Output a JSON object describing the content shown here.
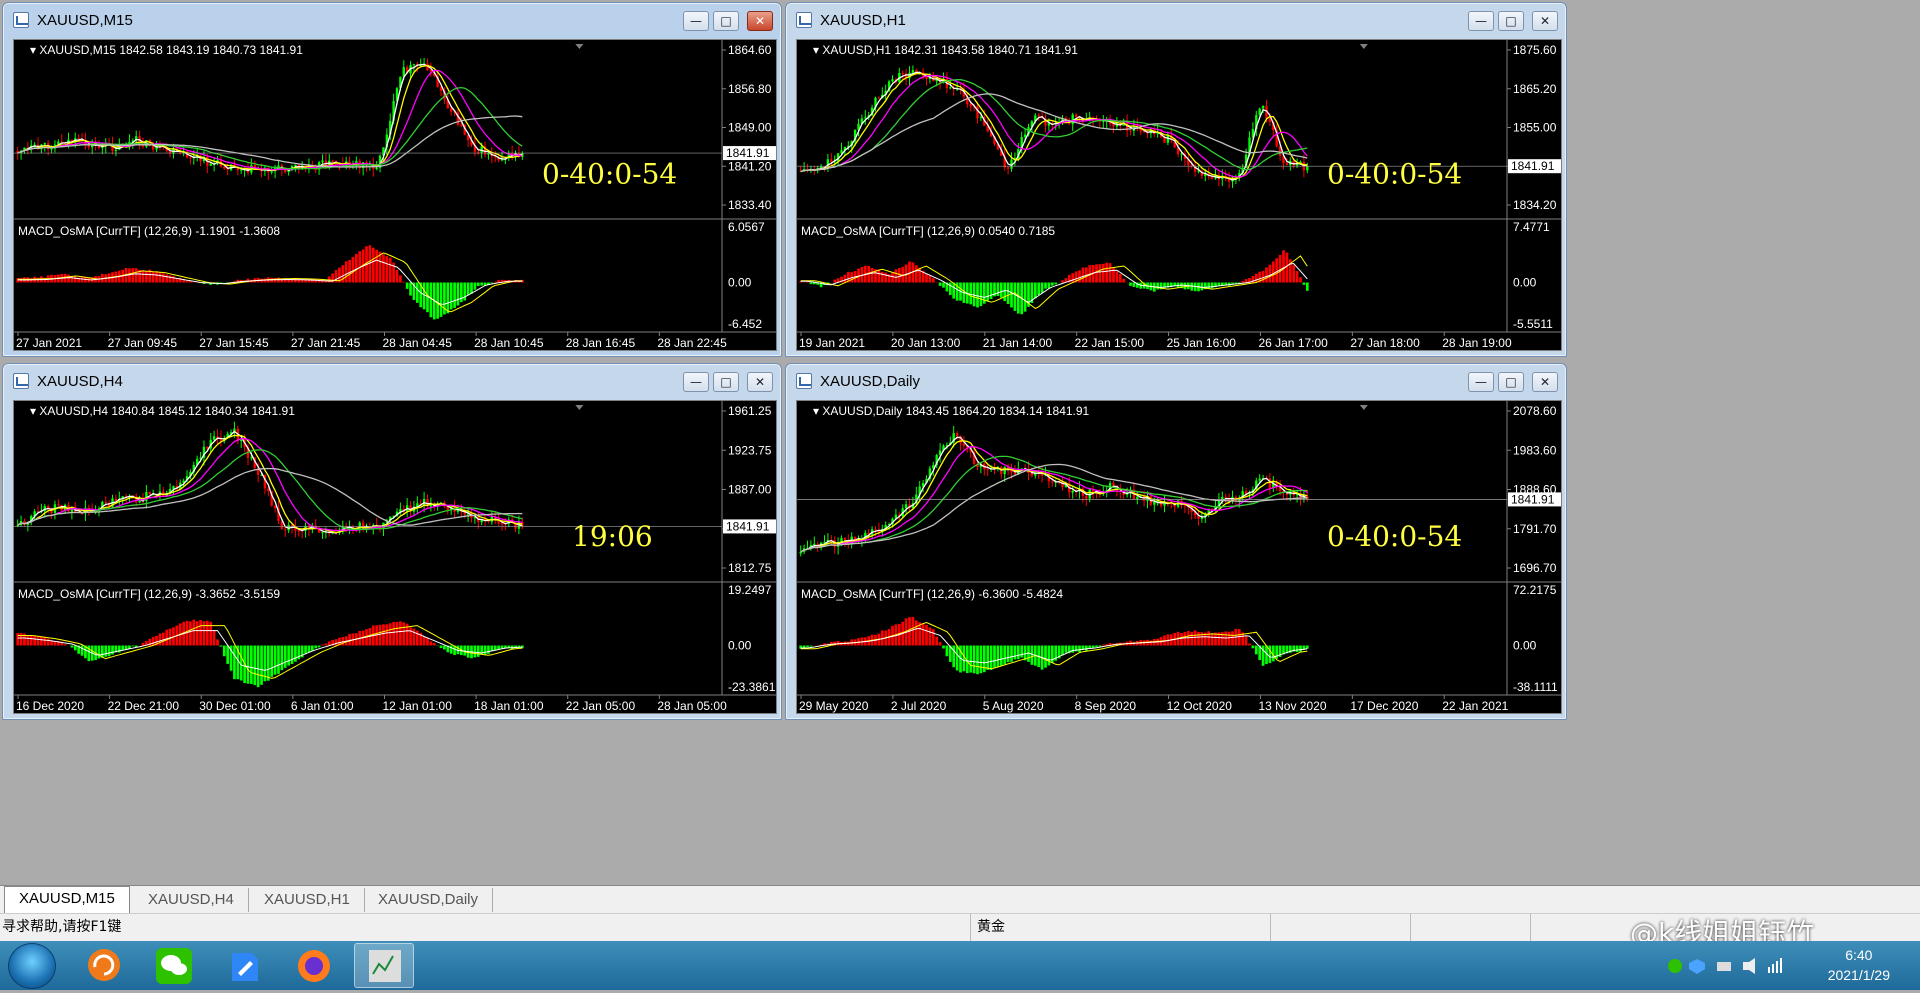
{
  "windows": [
    {
      "id": "m15",
      "title": "XAUUSD,M15",
      "active": true,
      "info": "XAUUSD,M15  1842.58 1843.19 1840.73 1841.91",
      "price_labels": [
        "1864.60",
        "1856.80",
        "1849.00",
        "1841.20",
        "1833.40"
      ],
      "current_price": "1841.91",
      "timer": "0-40:0-54",
      "macd_label": "MACD_OsMA [CurrTF] (12,26,9) -1.1901 -1.3608",
      "macd_labels": [
        "6.0567",
        "0.00",
        "-6.452"
      ],
      "time_labels": [
        "27 Jan 2021",
        "27 Jan 09:45",
        "27 Jan 15:45",
        "27 Jan 21:45",
        "28 Jan 04:45",
        "28 Jan 10:45",
        "28 Jan 16:45",
        "28 Jan 22:45"
      ]
    },
    {
      "id": "h1",
      "title": "XAUUSD,H1",
      "active": false,
      "info": "XAUUSD,H1  1842.31 1843.58 1840.71 1841.91",
      "price_labels": [
        "1875.60",
        "1865.20",
        "1855.00",
        "1844.60",
        "1834.20"
      ],
      "current_price": "1841.91",
      "timer": "0-40:0-54",
      "macd_label": "MACD_OsMA [CurrTF] (12,26,9) 0.0540 0.7185",
      "macd_labels": [
        "7.4771",
        "0.00",
        "-5.5511"
      ],
      "time_labels": [
        "19 Jan 2021",
        "20 Jan 13:00",
        "21 Jan 14:00",
        "22 Jan 15:00",
        "25 Jan 16:00",
        "26 Jan 17:00",
        "27 Jan 18:00",
        "28 Jan 19:00"
      ]
    },
    {
      "id": "h4",
      "title": "XAUUSD,H4",
      "active": false,
      "info": "XAUUSD,H4  1840.84 1845.12 1840.34 1841.91",
      "price_labels": [
        "1961.25",
        "1923.75",
        "1887.00",
        "1849.50",
        "1812.75"
      ],
      "current_price": "1841.91",
      "timer": "19:06",
      "macd_label": "MACD_OsMA [CurrTF] (12,26,9) -3.3652 -3.5159",
      "macd_labels": [
        "19.2497",
        "0.00",
        "-23.3861"
      ],
      "time_labels": [
        "16 Dec 2020",
        "22 Dec 21:00",
        "30 Dec 01:00",
        "6 Jan 01:00",
        "12 Jan 01:00",
        "18 Jan 01:00",
        "22 Jan 05:00",
        "28 Jan 05:00"
      ]
    },
    {
      "id": "d1",
      "title": "XAUUSD,Daily",
      "active": false,
      "info": "XAUUSD,Daily  1843.45 1864.20 1834.14 1841.91",
      "price_labels": [
        "2078.60",
        "1983.60",
        "1888.60",
        "1791.70",
        "1696.70"
      ],
      "current_price": "1841.91",
      "timer": "0-40:0-54",
      "macd_label": "MACD_OsMA [CurrTF] (12,26,9) -6.3600 -5.4824",
      "macd_labels": [
        "72.2175",
        "0.00",
        "-38.1111"
      ],
      "time_labels": [
        "29 May 2020",
        "2 Jul 2020",
        "5 Aug 2020",
        "8 Sep 2020",
        "12 Oct 2020",
        "13 Nov 2020",
        "17 Dec 2020",
        "22 Jan 2021"
      ]
    }
  ],
  "tabs": [
    "XAUUSD,M15",
    "XAUUSD,H4",
    "XAUUSD,H1",
    "XAUUSD,Daily"
  ],
  "status": {
    "help": "寻求帮助,请按F1键",
    "symbol": "黄金"
  },
  "watermark": "@k线姐姐钰竹",
  "clock": {
    "time": "6:40",
    "date": "2021/1/29"
  },
  "colors": {
    "bull_candle": "#00ff00",
    "bear_candle": "#ff0000",
    "ma_fast": "#ffffff",
    "ma_yellow": "#ffff00",
    "ma_magenta": "#ff00ff",
    "ma_green": "#32cd32",
    "ma_silver": "#c0c0c0",
    "timer_text": "#ffff40"
  }
}
